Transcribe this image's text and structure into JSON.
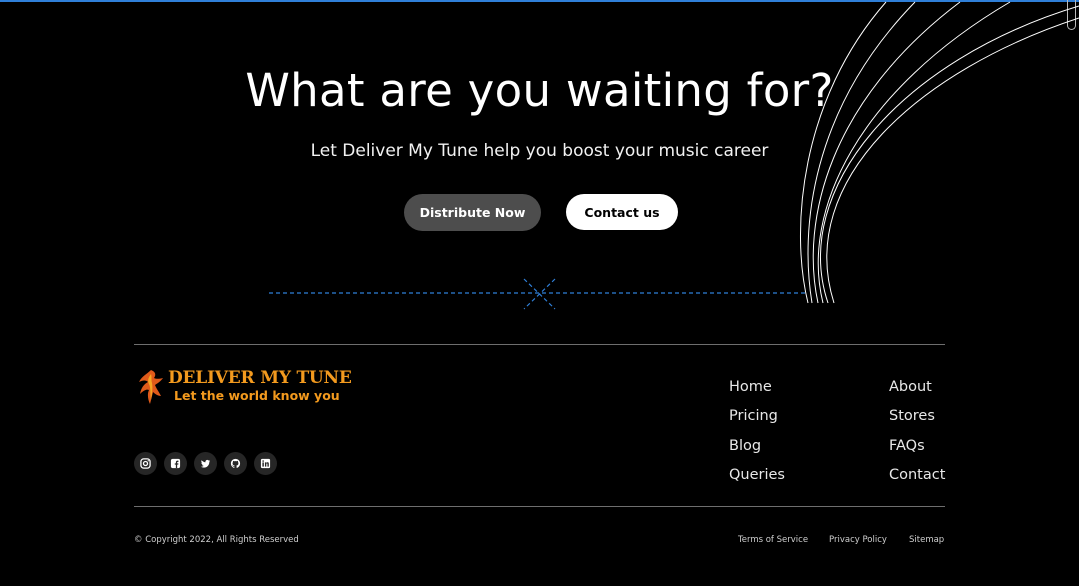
{
  "hero": {
    "title": "What are you waiting for?",
    "subtitle": "Let Deliver My Tune help you boost your music career",
    "primary_button": "Distribute Now",
    "secondary_button": "Contact us"
  },
  "brand": {
    "name": "DELIVER MY TUNE",
    "tagline": "Let the world know you",
    "logo_icon": "phoenix-bird-icon",
    "accent_color": "#f39a1e"
  },
  "socials": [
    {
      "icon": "instagram-icon"
    },
    {
      "icon": "facebook-icon"
    },
    {
      "icon": "twitter-icon"
    },
    {
      "icon": "github-icon"
    },
    {
      "icon": "linkedin-icon"
    }
  ],
  "nav": {
    "col1": [
      "Home",
      "Pricing",
      "Blog",
      "Queries"
    ],
    "col2": [
      "About",
      "Stores",
      "FAQs",
      "Contact"
    ]
  },
  "footer": {
    "copyright": "© Copyright 2022, All Rights Reserved",
    "terms": "Terms of Service",
    "privacy": "Privacy Policy",
    "sitemap": "Sitemap"
  },
  "colors": {
    "background": "#000000",
    "top_bar": "#2f7fd8",
    "primary_button_bg": "#4d4d4d",
    "secondary_button_bg": "#ffffff",
    "dashed_line": "#2f7fd8"
  }
}
